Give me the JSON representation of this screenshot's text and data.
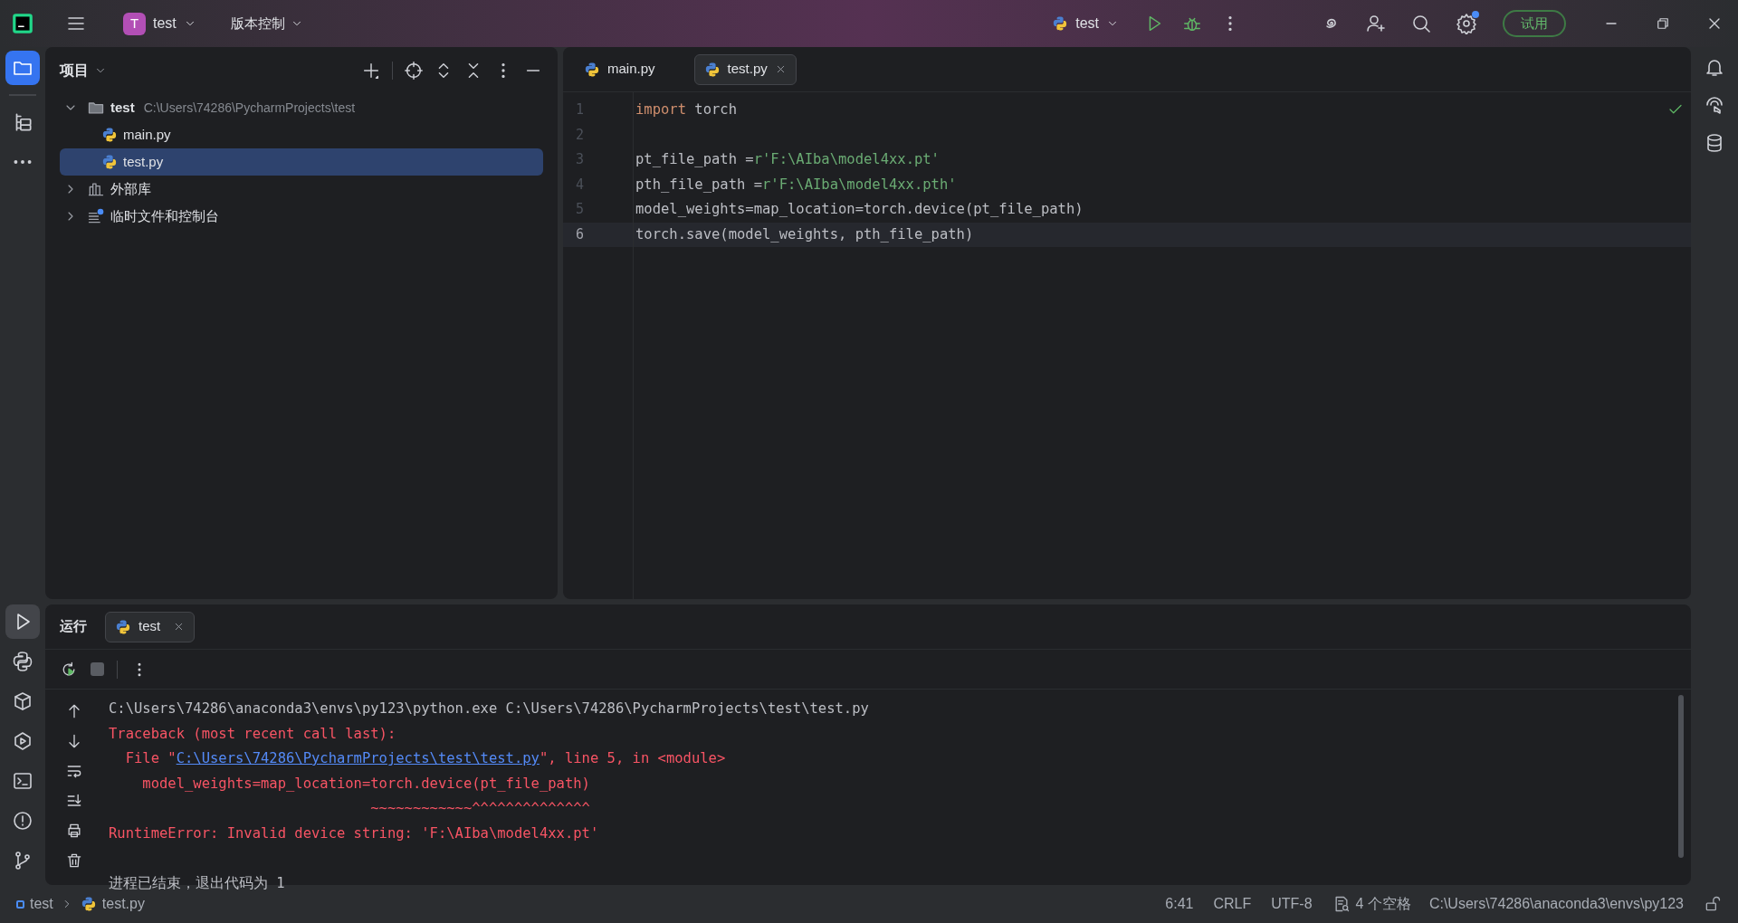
{
  "title_bar": {
    "project_initial": "T",
    "project": "test",
    "vcs": "版本控制",
    "run_config": "test",
    "trial_button": "试用"
  },
  "project_panel": {
    "title": "项目",
    "tree": [
      {
        "label": "test",
        "path": "C:\\Users\\74286\\PycharmProjects\\test",
        "kind": "folder",
        "expanded": true,
        "selected": false,
        "children": [
          {
            "label": "main.py",
            "kind": "python",
            "selected": false
          },
          {
            "label": "test.py",
            "kind": "python",
            "selected": true
          }
        ]
      },
      {
        "label": "外部库",
        "kind": "library",
        "expanded": false,
        "selected": false
      },
      {
        "label": "临时文件和控制台",
        "kind": "scratch",
        "expanded": false,
        "selected": false
      }
    ]
  },
  "editor": {
    "tabs": [
      {
        "label": "main.py",
        "selected": false
      },
      {
        "label": "test.py",
        "selected": true
      }
    ],
    "lines": [
      {
        "number": "1",
        "current": false,
        "tokens": [
          {
            "kind": "keyword",
            "text": "import"
          },
          {
            "kind": "plain",
            "text": " torch"
          }
        ]
      },
      {
        "number": "2",
        "current": false
      },
      {
        "number": "3",
        "current": false,
        "tokens": [
          {
            "kind": "plain",
            "text": "pt_file_path ="
          },
          {
            "kind": "string",
            "text": "r'F:\\AIba\\model4xx.pt'"
          }
        ]
      },
      {
        "number": "4",
        "current": false,
        "tokens": [
          {
            "kind": "plain",
            "text": "pth_file_path ="
          },
          {
            "kind": "string",
            "text": "r'F:\\AIba\\model4xx.pth'"
          }
        ]
      },
      {
        "number": "5",
        "current": false,
        "tokens": [
          {
            "kind": "plain",
            "text": "model_weights=map_location=torch.device(pt_file_path)"
          }
        ]
      },
      {
        "number": "6",
        "current": true,
        "tokens": [
          {
            "kind": "plain",
            "text": "torch.save(model_weights, pth_file_path)"
          }
        ]
      }
    ]
  },
  "run_panel": {
    "title": "运行",
    "tabs": [
      {
        "label": "test",
        "selected": true
      }
    ],
    "output": [
      {
        "kind": "text",
        "segments": [
          {
            "kind": "plain",
            "text": "C:\\Users\\74286\\anaconda3\\envs\\py123\\python.exe C:\\Users\\74286\\PycharmProjects\\test\\test.py"
          }
        ]
      },
      {
        "kind": "text",
        "segments": [
          {
            "kind": "error",
            "text": "Traceback (most recent call last):"
          }
        ]
      },
      {
        "kind": "text",
        "segments": [
          {
            "kind": "error",
            "text": "  File \""
          },
          {
            "kind": "link",
            "text": "C:\\Users\\74286\\PycharmProjects\\test\\test.py"
          },
          {
            "kind": "error",
            "text": "\", line 5, in <module>"
          }
        ]
      },
      {
        "kind": "text",
        "segments": [
          {
            "kind": "error",
            "text": "    model_weights=map_location=torch.device(pt_file_path)"
          }
        ]
      },
      {
        "kind": "text",
        "segments": [
          {
            "kind": "error",
            "text": "                               ~~~~~~~~~~~~^^^^^^^^^^^^^^"
          }
        ]
      },
      {
        "kind": "text",
        "segments": [
          {
            "kind": "error",
            "text": "RuntimeError: Invalid device string: 'F:\\AIba\\model4xx.pt'"
          }
        ]
      },
      {
        "kind": "blank"
      },
      {
        "kind": "text",
        "segments": [
          {
            "kind": "plain",
            "text": "进程已结束，退出代码为 1"
          }
        ]
      }
    ]
  },
  "status_bar": {
    "breadcrumb": [
      "test",
      "test.py"
    ],
    "position": "6:41",
    "line_separator": "CRLF",
    "encoding": "UTF-8",
    "indent": "4 个空格",
    "interpreter": "C:\\Users\\74286\\anaconda3\\envs\\py123"
  }
}
